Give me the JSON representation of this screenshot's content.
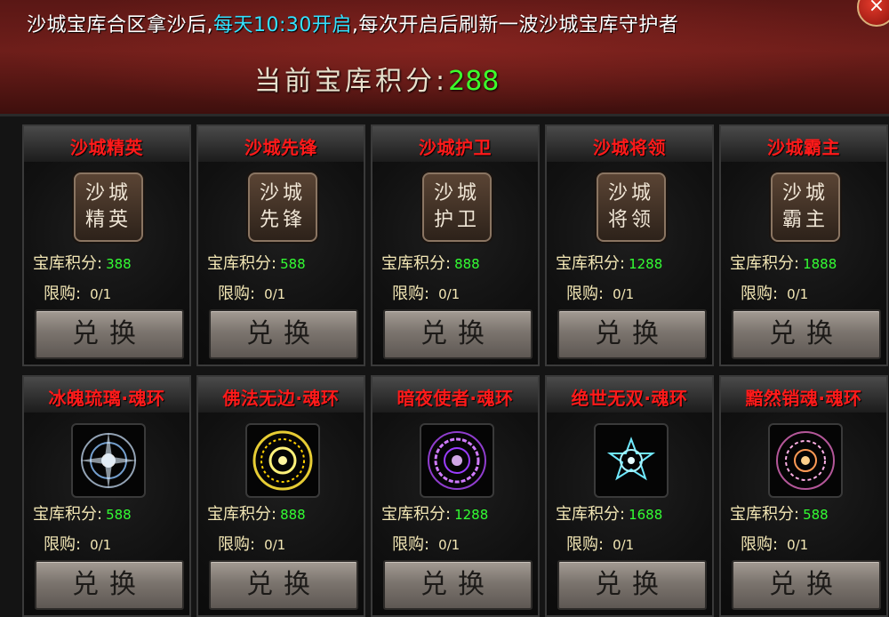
{
  "header": {
    "notice_prefix": "沙城宝库合区拿沙后,",
    "notice_highlight": "每天10:30开启",
    "notice_suffix": ",每次开启后刷新一波沙城宝库守护者",
    "score_label": "当前宝库积分:",
    "score_value": "288",
    "close_symbol": "×"
  },
  "colors": {
    "title_red": "#ff1a1a",
    "highlight_cyan": "#34e1ff",
    "score_green": "#3cff2c",
    "label_gold": "#f3e7b5"
  },
  "guardians": [
    {
      "title": "沙城精英",
      "tile": "沙城\n精英",
      "score_label": "宝库积分:",
      "score": "388",
      "limit_label": "限购:",
      "limit": "0/1",
      "button": "兑换"
    },
    {
      "title": "沙城先锋",
      "tile": "沙城\n先锋",
      "score_label": "宝库积分:",
      "score": "588",
      "limit_label": "限购:",
      "limit": "0/1",
      "button": "兑换"
    },
    {
      "title": "沙城护卫",
      "tile": "沙城\n护卫",
      "score_label": "宝库积分:",
      "score": "888",
      "limit_label": "限购:",
      "limit": "0/1",
      "button": "兑换"
    },
    {
      "title": "沙城将领",
      "tile": "沙城\n将领",
      "score_label": "宝库积分:",
      "score": "1288",
      "limit_label": "限购:",
      "limit": "0/1",
      "button": "兑换"
    },
    {
      "title": "沙城霸主",
      "tile": "沙城\n霸主",
      "score_label": "宝库积分:",
      "score": "1888",
      "limit_label": "限购:",
      "limit": "0/1",
      "button": "兑换"
    }
  ],
  "rings": [
    {
      "title": "冰魄琉璃·魂环",
      "icon": "ice-soul-ring-icon",
      "color": "#cfe6ff",
      "score_label": "宝库积分:",
      "score": "588",
      "limit_label": "限购:",
      "limit": "0/1",
      "button": "兑换"
    },
    {
      "title": "佛法无边·魂环",
      "icon": "buddha-soul-ring-icon",
      "color": "#ffe23a",
      "score_label": "宝库积分:",
      "score": "888",
      "limit_label": "限购:",
      "limit": "0/1",
      "button": "兑换"
    },
    {
      "title": "暗夜使者·魂环",
      "icon": "night-soul-ring-icon",
      "color": "#b24bff",
      "score_label": "宝库积分:",
      "score": "1288",
      "limit_label": "限购:",
      "limit": "0/1",
      "button": "兑换"
    },
    {
      "title": "绝世无双·魂环",
      "icon": "peerless-soul-ring-icon",
      "color": "#6fe9ff",
      "score_label": "宝库积分:",
      "score": "1688",
      "limit_label": "限购:",
      "limit": "0/1",
      "button": "兑换"
    },
    {
      "title": "黯然销魂·魂环",
      "icon": "shadow-soul-ring-icon",
      "color": "#ff7ad8",
      "score_label": "宝库积分:",
      "score": "588",
      "limit_label": "限购:",
      "limit": "0/1",
      "button": "兑换"
    }
  ]
}
